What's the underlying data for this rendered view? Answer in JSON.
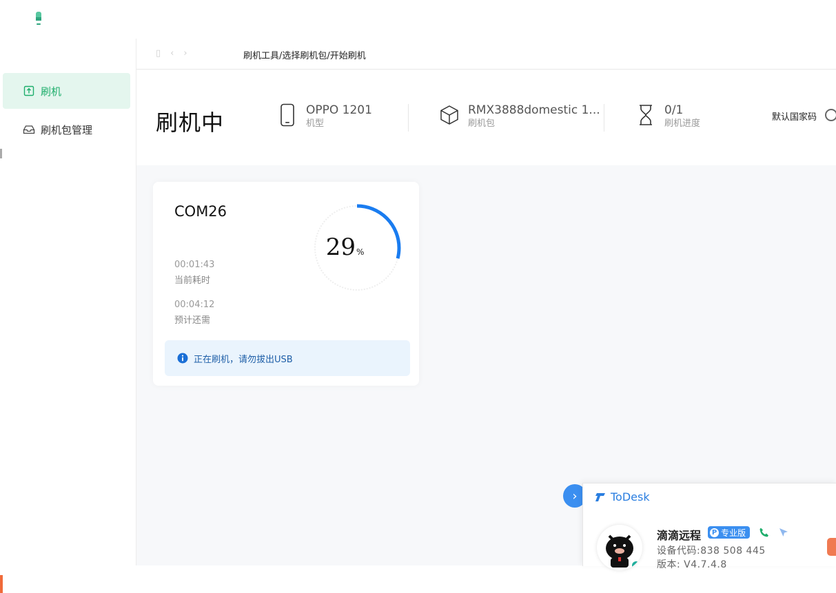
{
  "sidebar": {
    "items": [
      {
        "label": "刷机",
        "icon": "upload-box-icon",
        "active": true
      },
      {
        "label": "刷机包管理",
        "icon": "inbox-icon",
        "active": false
      }
    ]
  },
  "navbar": {
    "breadcrumb": "刷机工具/选择刷机包/开始刷机"
  },
  "header": {
    "title": "刷机中",
    "device": {
      "value": "OPPO 1201",
      "label": "机型",
      "icon": "phone-icon"
    },
    "package": {
      "value": "RMX3888domestic 1...",
      "label": "刷机包",
      "icon": "box-icon"
    },
    "progress": {
      "value": "0/1",
      "label": "刷机进度",
      "icon": "hourglass-icon"
    },
    "region_label": "默认国家码"
  },
  "card": {
    "port": "COM26",
    "percent_value": 29,
    "percent_text": "29",
    "percent_unit": "%",
    "elapsed_time": "00:01:43",
    "elapsed_label": "当前耗时",
    "remaining_time": "00:04:12",
    "remaining_label": "预计还需",
    "notice": "正在刷机，请勿拔出USB"
  },
  "todesk": {
    "brand": "ToDesk",
    "name": "滴滴远程",
    "badge": "专业版",
    "badge_letter": "P",
    "device_code": "设备代码:838 508 445",
    "version": "版本: V4.7.4.8"
  },
  "colors": {
    "accent_green": "#1fae6c",
    "progress_blue": "#1a7cf0",
    "todesk_blue": "#2a7ee0"
  }
}
